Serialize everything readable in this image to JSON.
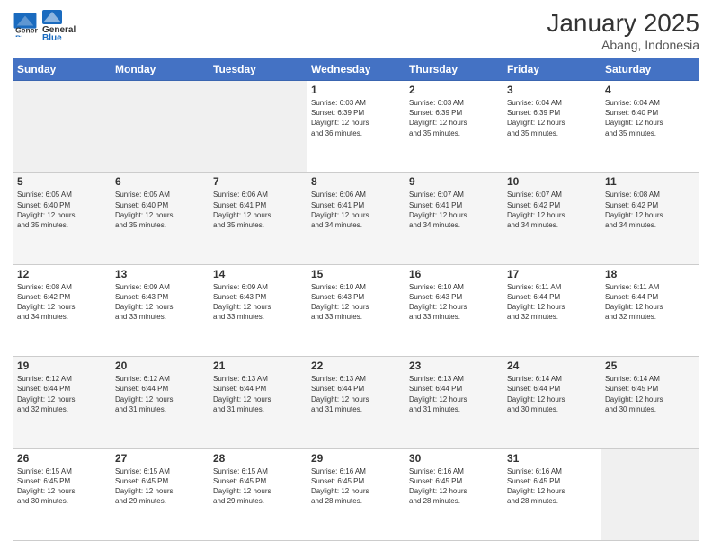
{
  "header": {
    "logo_general": "General",
    "logo_blue": "Blue",
    "month_title": "January 2025",
    "location": "Abang, Indonesia"
  },
  "weekdays": [
    "Sunday",
    "Monday",
    "Tuesday",
    "Wednesday",
    "Thursday",
    "Friday",
    "Saturday"
  ],
  "weeks": [
    [
      {
        "day": "",
        "info": ""
      },
      {
        "day": "",
        "info": ""
      },
      {
        "day": "",
        "info": ""
      },
      {
        "day": "1",
        "info": "Sunrise: 6:03 AM\nSunset: 6:39 PM\nDaylight: 12 hours\nand 36 minutes."
      },
      {
        "day": "2",
        "info": "Sunrise: 6:03 AM\nSunset: 6:39 PM\nDaylight: 12 hours\nand 35 minutes."
      },
      {
        "day": "3",
        "info": "Sunrise: 6:04 AM\nSunset: 6:39 PM\nDaylight: 12 hours\nand 35 minutes."
      },
      {
        "day": "4",
        "info": "Sunrise: 6:04 AM\nSunset: 6:40 PM\nDaylight: 12 hours\nand 35 minutes."
      }
    ],
    [
      {
        "day": "5",
        "info": "Sunrise: 6:05 AM\nSunset: 6:40 PM\nDaylight: 12 hours\nand 35 minutes."
      },
      {
        "day": "6",
        "info": "Sunrise: 6:05 AM\nSunset: 6:40 PM\nDaylight: 12 hours\nand 35 minutes."
      },
      {
        "day": "7",
        "info": "Sunrise: 6:06 AM\nSunset: 6:41 PM\nDaylight: 12 hours\nand 35 minutes."
      },
      {
        "day": "8",
        "info": "Sunrise: 6:06 AM\nSunset: 6:41 PM\nDaylight: 12 hours\nand 34 minutes."
      },
      {
        "day": "9",
        "info": "Sunrise: 6:07 AM\nSunset: 6:41 PM\nDaylight: 12 hours\nand 34 minutes."
      },
      {
        "day": "10",
        "info": "Sunrise: 6:07 AM\nSunset: 6:42 PM\nDaylight: 12 hours\nand 34 minutes."
      },
      {
        "day": "11",
        "info": "Sunrise: 6:08 AM\nSunset: 6:42 PM\nDaylight: 12 hours\nand 34 minutes."
      }
    ],
    [
      {
        "day": "12",
        "info": "Sunrise: 6:08 AM\nSunset: 6:42 PM\nDaylight: 12 hours\nand 34 minutes."
      },
      {
        "day": "13",
        "info": "Sunrise: 6:09 AM\nSunset: 6:43 PM\nDaylight: 12 hours\nand 33 minutes."
      },
      {
        "day": "14",
        "info": "Sunrise: 6:09 AM\nSunset: 6:43 PM\nDaylight: 12 hours\nand 33 minutes."
      },
      {
        "day": "15",
        "info": "Sunrise: 6:10 AM\nSunset: 6:43 PM\nDaylight: 12 hours\nand 33 minutes."
      },
      {
        "day": "16",
        "info": "Sunrise: 6:10 AM\nSunset: 6:43 PM\nDaylight: 12 hours\nand 33 minutes."
      },
      {
        "day": "17",
        "info": "Sunrise: 6:11 AM\nSunset: 6:44 PM\nDaylight: 12 hours\nand 32 minutes."
      },
      {
        "day": "18",
        "info": "Sunrise: 6:11 AM\nSunset: 6:44 PM\nDaylight: 12 hours\nand 32 minutes."
      }
    ],
    [
      {
        "day": "19",
        "info": "Sunrise: 6:12 AM\nSunset: 6:44 PM\nDaylight: 12 hours\nand 32 minutes."
      },
      {
        "day": "20",
        "info": "Sunrise: 6:12 AM\nSunset: 6:44 PM\nDaylight: 12 hours\nand 31 minutes."
      },
      {
        "day": "21",
        "info": "Sunrise: 6:13 AM\nSunset: 6:44 PM\nDaylight: 12 hours\nand 31 minutes."
      },
      {
        "day": "22",
        "info": "Sunrise: 6:13 AM\nSunset: 6:44 PM\nDaylight: 12 hours\nand 31 minutes."
      },
      {
        "day": "23",
        "info": "Sunrise: 6:13 AM\nSunset: 6:44 PM\nDaylight: 12 hours\nand 31 minutes."
      },
      {
        "day": "24",
        "info": "Sunrise: 6:14 AM\nSunset: 6:44 PM\nDaylight: 12 hours\nand 30 minutes."
      },
      {
        "day": "25",
        "info": "Sunrise: 6:14 AM\nSunset: 6:45 PM\nDaylight: 12 hours\nand 30 minutes."
      }
    ],
    [
      {
        "day": "26",
        "info": "Sunrise: 6:15 AM\nSunset: 6:45 PM\nDaylight: 12 hours\nand 30 minutes."
      },
      {
        "day": "27",
        "info": "Sunrise: 6:15 AM\nSunset: 6:45 PM\nDaylight: 12 hours\nand 29 minutes."
      },
      {
        "day": "28",
        "info": "Sunrise: 6:15 AM\nSunset: 6:45 PM\nDaylight: 12 hours\nand 29 minutes."
      },
      {
        "day": "29",
        "info": "Sunrise: 6:16 AM\nSunset: 6:45 PM\nDaylight: 12 hours\nand 28 minutes."
      },
      {
        "day": "30",
        "info": "Sunrise: 6:16 AM\nSunset: 6:45 PM\nDaylight: 12 hours\nand 28 minutes."
      },
      {
        "day": "31",
        "info": "Sunrise: 6:16 AM\nSunset: 6:45 PM\nDaylight: 12 hours\nand 28 minutes."
      },
      {
        "day": "",
        "info": ""
      }
    ]
  ]
}
